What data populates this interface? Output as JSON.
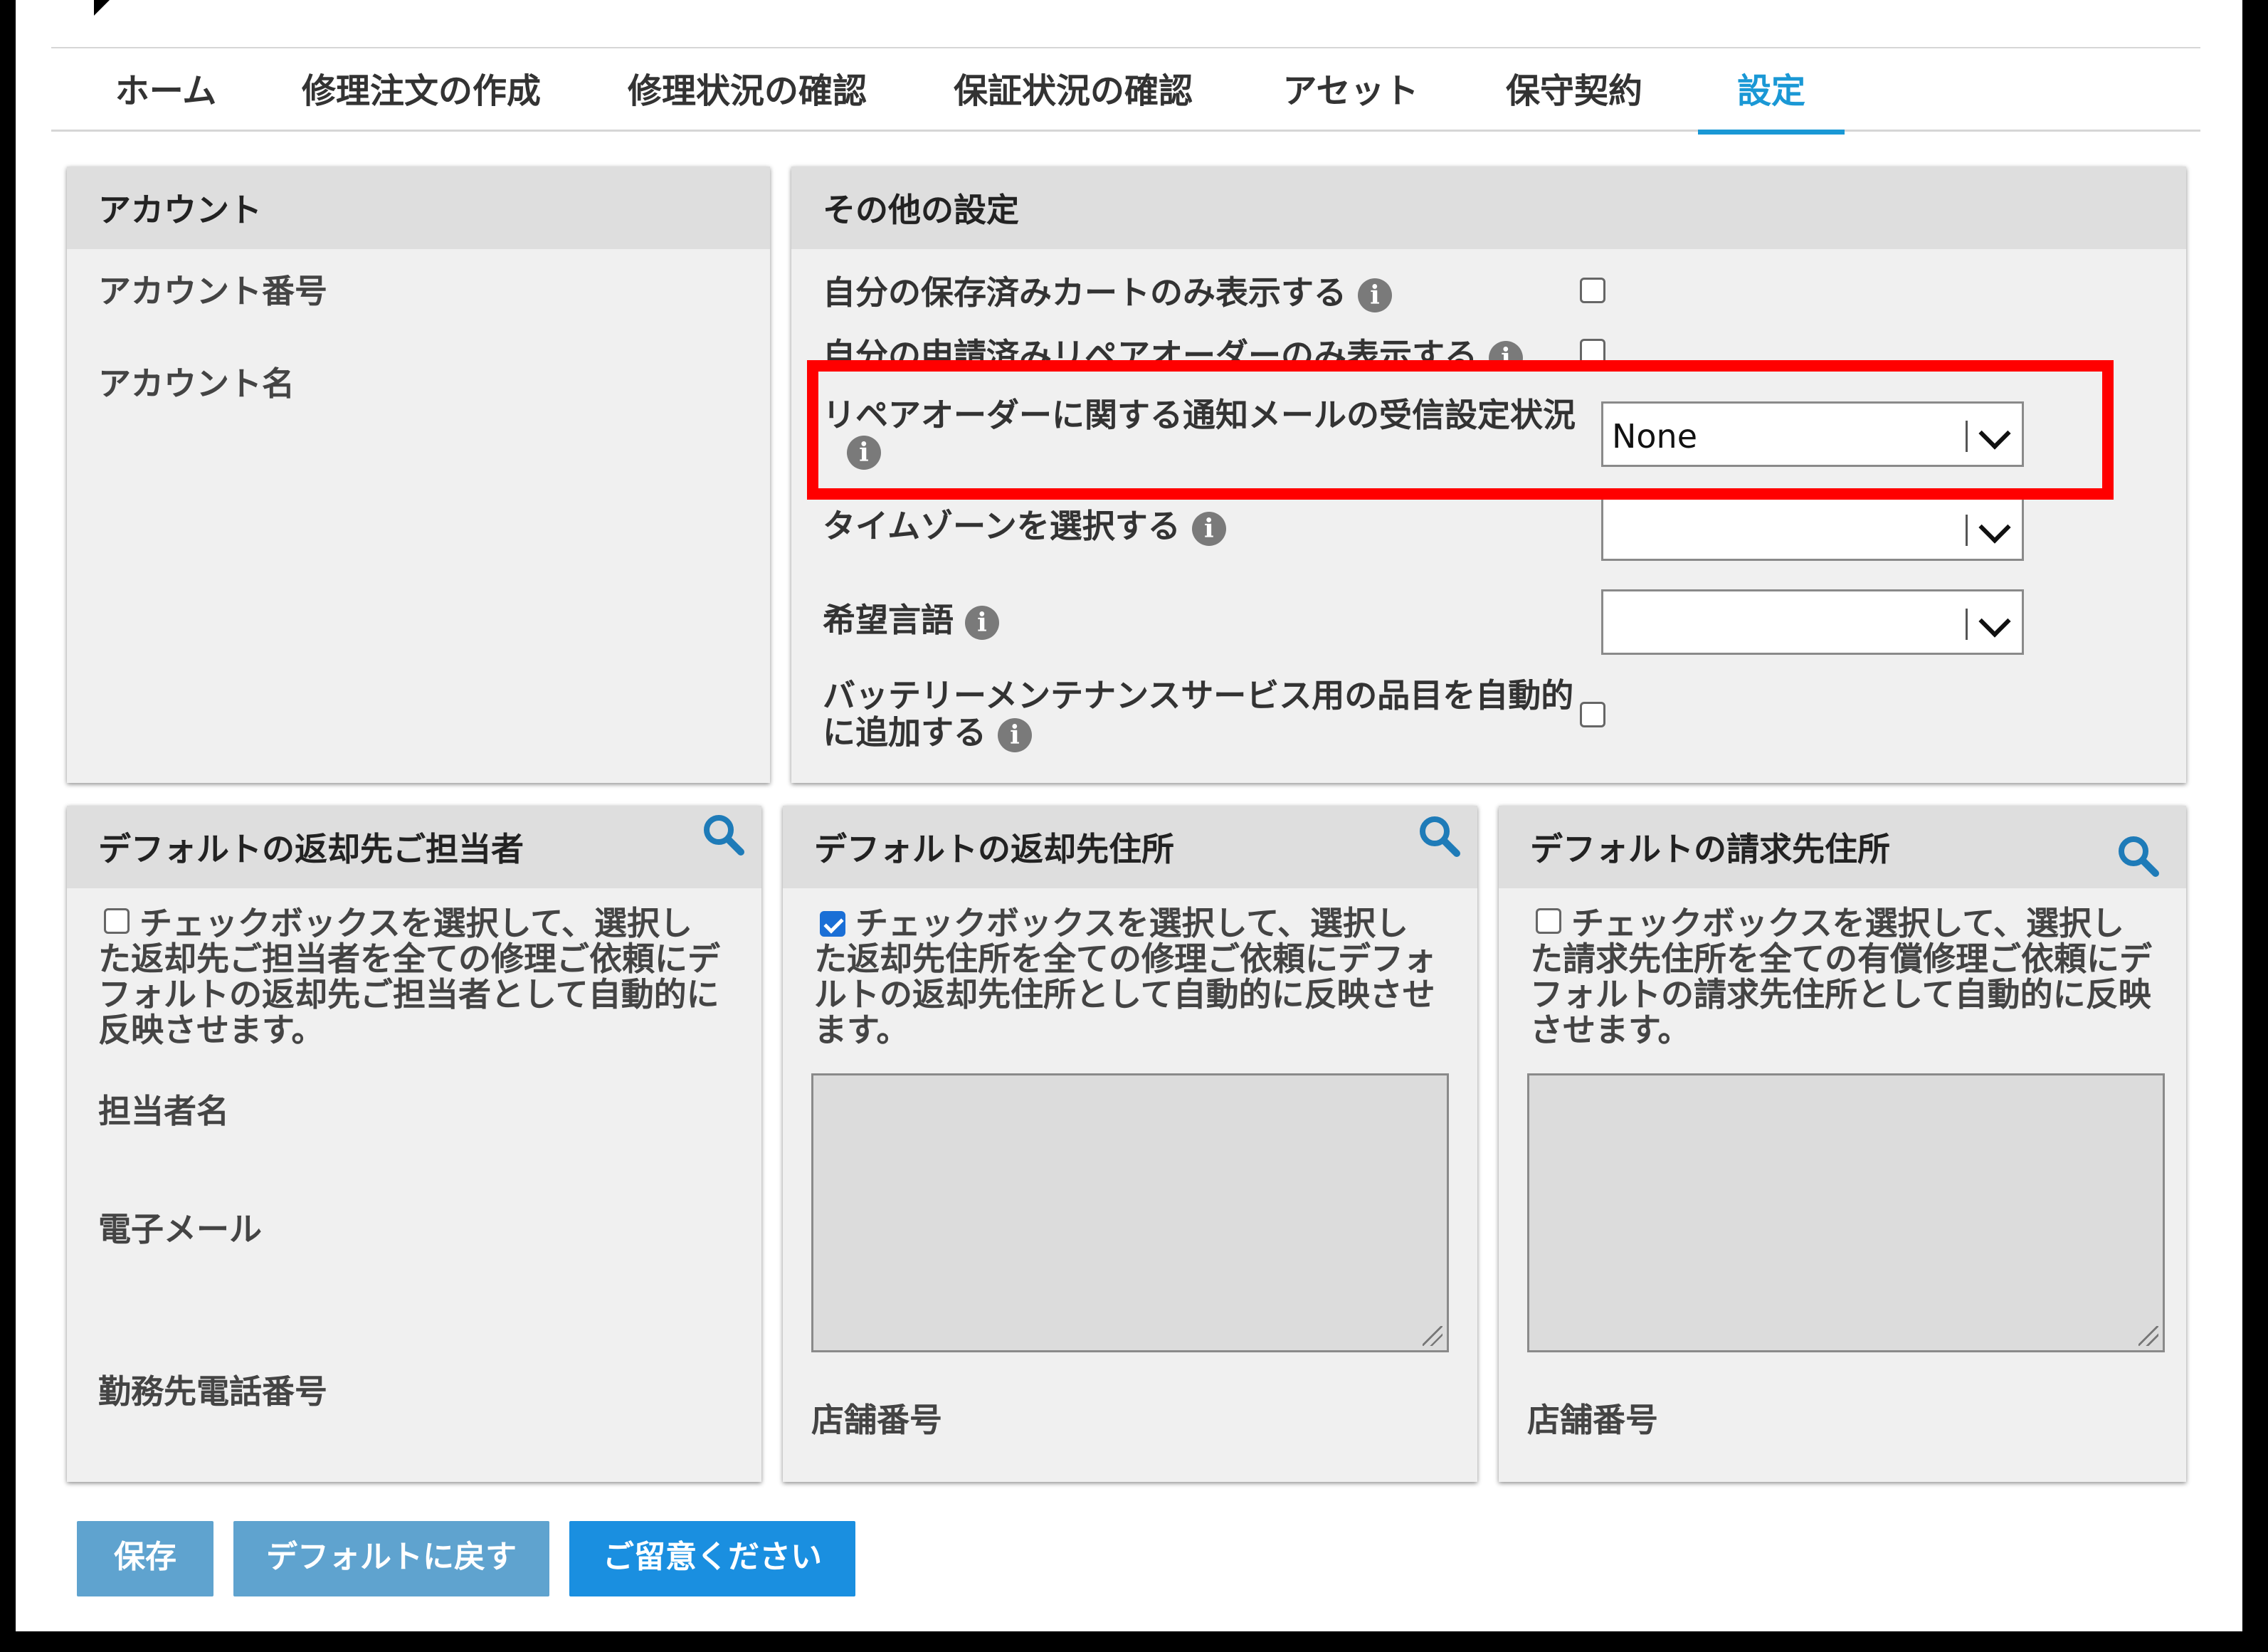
{
  "tabs": [
    {
      "label": "ホーム"
    },
    {
      "label": "修理注文の作成"
    },
    {
      "label": "修理状況の確認"
    },
    {
      "label": "保証状況の確認"
    },
    {
      "label": "アセット"
    },
    {
      "label": "保守契約"
    },
    {
      "label": "設定",
      "active": true
    }
  ],
  "account": {
    "title": "アカウント",
    "number_label": "アカウント番号",
    "name_label": "アカウント名"
  },
  "other": {
    "title": "その他の設定",
    "saved_cart_label": "自分の保存済みカートのみ表示する",
    "repair_order_label": "自分の申請済みリペアオーダーのみ表示する",
    "notify_label": "リペアオーダーに関する通知メールの受信設定状況",
    "notify_value": "None",
    "timezone_label": "タイムゾーンを選択する",
    "timezone_value": "",
    "language_label": "希望言語",
    "language_value": "",
    "battery_label_1": "バッテリーメンテナンスサービス用の品目を自動的",
    "battery_label_2": "に追加する"
  },
  "return_contact": {
    "title": "デフォルトの返却先ご担当者",
    "desc_1": "チェックボックスを選択して、選択し",
    "desc_2": "た返却先ご担当者を全ての修理ご依頼にデ",
    "desc_3": "フォルトの返却先ご担当者として自動的に",
    "desc_4": "反映させます。",
    "checked": false,
    "contact_name_label": "担当者名",
    "email_label": "電子メール",
    "phone_label": "勤務先電話番号"
  },
  "return_address": {
    "title": "デフォルトの返却先住所",
    "desc_1": "チェックボックスを選択して、選択し",
    "desc_2": "た返却先住所を全ての修理ご依頼にデフォ",
    "desc_3": "ルトの返却先住所として自動的に反映させ",
    "desc_4": "ます。",
    "checked": true,
    "store_label": "店舗番号"
  },
  "billing_address": {
    "title": "デフォルトの請求先住所",
    "desc_1": "チェックボックスを選択して、選択し",
    "desc_2": "た請求先住所を全ての有償修理ご依頼にデ",
    "desc_3": "フォルトの請求先住所として自動的に反映",
    "desc_4": "させます。",
    "checked": false,
    "store_label": "店舗番号"
  },
  "buttons": {
    "save": "保存",
    "reset": "デフォルトに戻す",
    "notice": "ご留意ください"
  },
  "icons": {
    "info": "i",
    "search": "search-icon"
  },
  "colors": {
    "accent": "#1a98d5",
    "primary_button": "#1a8fe0",
    "disabled_button": "#5fa3cf",
    "highlight": "#ff0000"
  }
}
